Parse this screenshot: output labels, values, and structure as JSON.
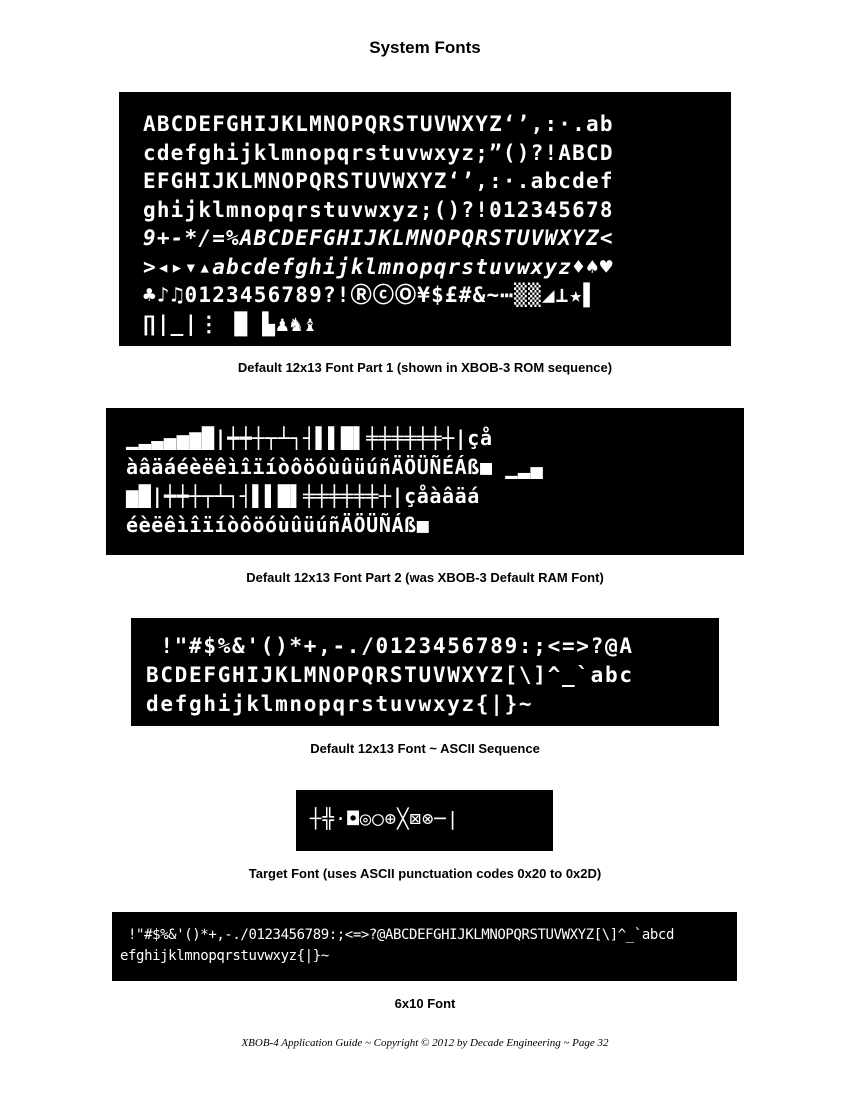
{
  "page_title": "System Fonts",
  "fonts": [
    {
      "lines": [
        "ABCDEFGHIJKLMNOPQRSTUVWXYZ‘’,:·.ab",
        "cdefghijklmnopqrstuvwxyz;”()?!ABCD",
        "EFGHIJKLMNOPQRSTUVWXYZ‘’,:·.abcdef",
        "ghijklmnopqrstuvwxyz;()?!012345678",
        "9+-*/=%ABCDEFGHIJKLMNOPQRSTUVWXYZ<",
        ">◂▸▾▴abcdefghijklmnopqrstuvwxyz♦♠♥",
        "♣♪♫0123456789?!ⓇⓒⓄ¥$£#&~⋯▒▒◢⊥★▌",
        "∏|_|⋮ █ ▙♟♞♝"
      ],
      "caption": "Default 12x13 Font Part 1 (shown in XBOB-3 ROM sequence)"
    },
    {
      "lines": [
        "▁▂▃▄▅▆█|┿┿┼┬┴┐┤▌▌█▌╪╪╪╪╪╪┼|çå",
        "àâäáéèëêìîïíòôöóùûüúñÄÖÜÑÉÁß■ ▁▂▄",
        "▆█|┿┿┼┬┴┐┤▌▌█▌╪╪╪╪╪╪┼|çåàâäá",
        "éèëêìîïíòôöóùûüúñÄÖÜÑÁß■"
      ],
      "caption": "Default 12x13 Font Part 2 (was XBOB-3 Default RAM Font)"
    },
    {
      "lines": [
        " !\"#$%&'()*+,-./0123456789:;<=>?@A",
        "BCDEFGHIJKLMNOPQRSTUVWXYZ[\\]^_`abc",
        "defghijklmnopqrstuvwxyz{|}~"
      ],
      "caption": "Default 12x13 Font ~ ASCII Sequence"
    },
    {
      "lines": [
        "┼╬·◘◎◯⊕╳⊠⊗─|"
      ],
      "caption": "Target Font (uses ASCII punctuation codes 0x20 to 0x2D)"
    },
    {
      "lines": [
        " !\"#$%&'()*+,-./0123456789:;<=>?@ABCDEFGHIJKLMNOPQRSTUVWXYZ[\\]^_`abcd",
        "efghijklmnopqrstuvwxyz{|}~"
      ],
      "caption": "6x10 Font"
    }
  ],
  "footer": "XBOB-4 Application Guide  ~  Copyright © 2012 by Decade Engineering  ~  Page 32"
}
